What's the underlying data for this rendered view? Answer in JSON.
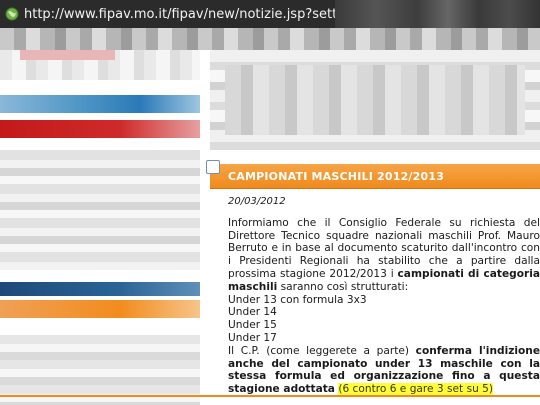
{
  "browser": {
    "url": "http://www.fipav.mo.it/fipav/new/notizie.jsp?settore=c"
  },
  "news": {
    "title": "CAMPIONATI MASCHILI 2012/2013",
    "date": "20/03/2012",
    "intro_part1": "Informiamo che il Consiglio Federale su richiesta del Direttore Tecnico squadre nazionali maschili Prof. Mauro Berruto e in base al documento scaturito dall'incontro con i Presidenti Regionali ha stabilito che a partire dalla prossima stagione 2012/2013 i ",
    "intro_bold": "campionati di categoria maschili",
    "intro_part2": " saranno così strutturati:",
    "items": [
      "Under 13 con formula 3x3",
      "Under 14",
      "Under 15",
      "Under 17"
    ],
    "note_part1": "Il C.P. (come leggerete a parte) ",
    "note_bold": "conferma l'indizione anche del campionato under 13 maschile con la stessa formula ed organizzazione fino a questa stagione adottata",
    "note_highlight": "(6 contro 6 e gare 3 set su 5)"
  },
  "colors": {
    "accent_orange": "#f08a1d",
    "highlight_yellow": "#fffc3a"
  },
  "icons": {
    "address_icon": "globe-icon"
  }
}
